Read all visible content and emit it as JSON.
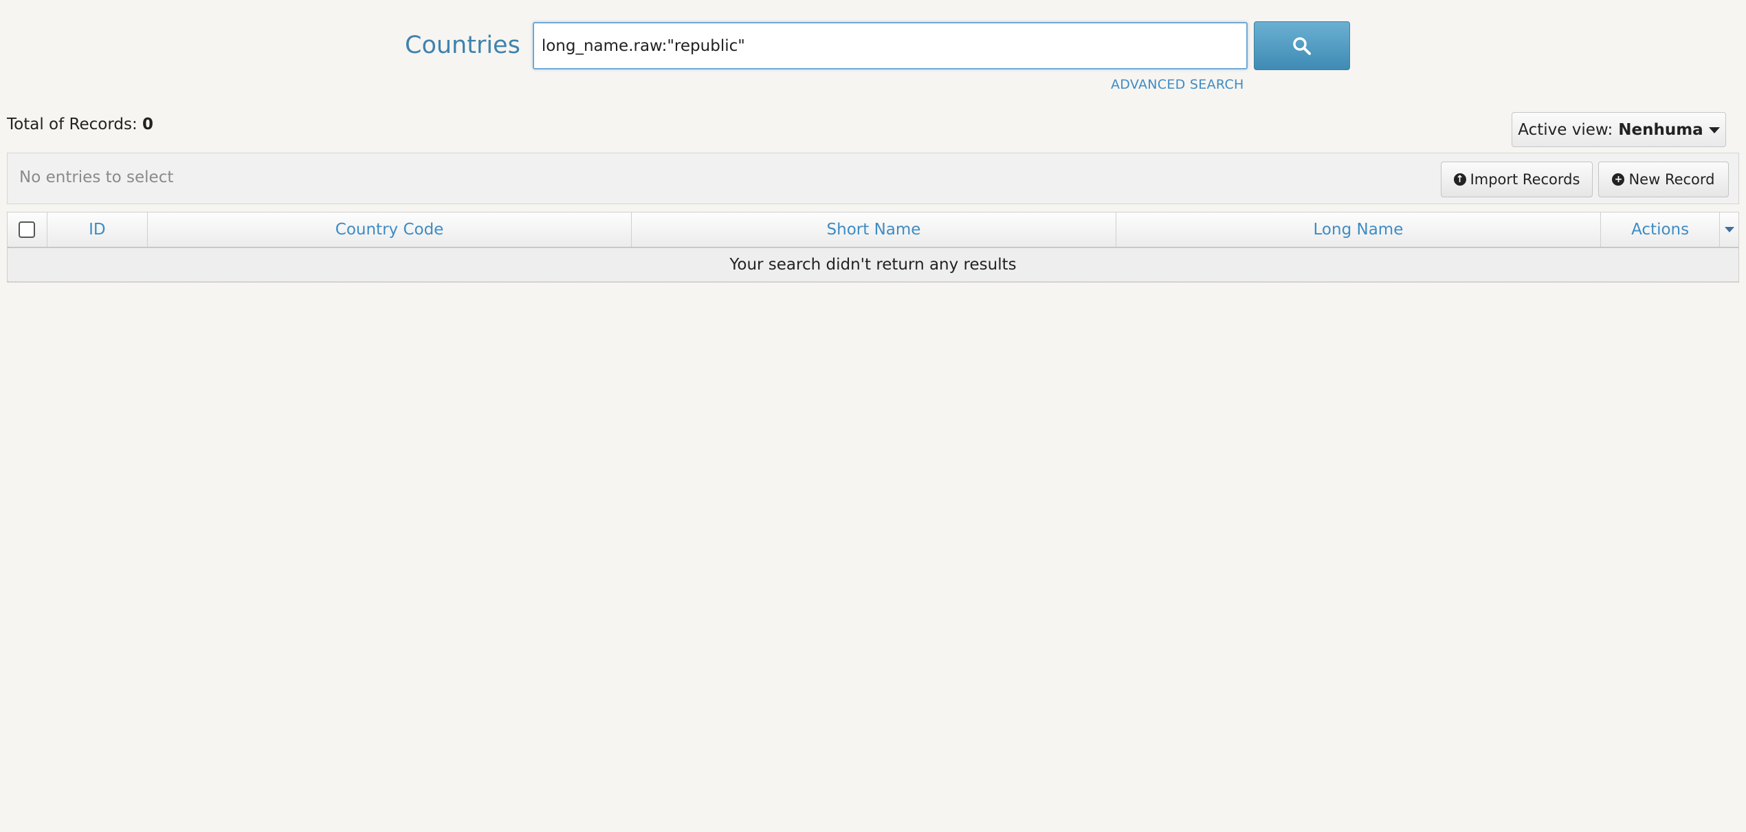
{
  "header": {
    "title": "Countries",
    "search_value": "long_name.raw:\"republic\"",
    "search_button_icon": "search-icon",
    "advanced_search_label": "ADVANCED SEARCH"
  },
  "records": {
    "total_label": "Total of Records:",
    "total_count": "0"
  },
  "view": {
    "label": "Active view:",
    "name": "Nenhuma"
  },
  "toolbar": {
    "selection_text": "No entries to select",
    "import_label": "Import Records",
    "import_icon": "arrow-up-circle-icon",
    "new_label": "New Record",
    "new_icon": "plus-circle-icon"
  },
  "table": {
    "columns": [
      "ID",
      "Country Code",
      "Short Name",
      "Long Name",
      "Actions"
    ],
    "empty_message": "Your search didn't return any results"
  },
  "colors": {
    "accent": "#3e82ad",
    "link": "#3e8cc4",
    "background": "#f6f5f1"
  }
}
